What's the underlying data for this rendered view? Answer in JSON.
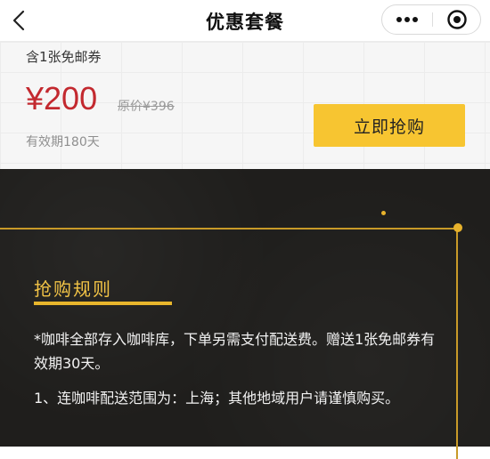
{
  "header": {
    "title": "优惠套餐",
    "back_icon": "chevron-left-icon",
    "more_icon": "more-dots-icon",
    "close_icon": "target-close-icon"
  },
  "product": {
    "coupon_text": "含1张免邮券",
    "price": "¥200",
    "original_price": "原价¥396",
    "validity": "有效期180天",
    "buy_label": "立即抢购"
  },
  "rules": {
    "title": "抢购规则",
    "paragraphs": [
      "*咖啡全部存入咖啡库，下单另需支付配送费。赠送1张免邮券有效期30天。",
      "1、连咖啡配送范围为：上海；其他地域用户请谨慎购买。"
    ]
  },
  "colors": {
    "price": "#c3292f",
    "accent": "#f7c531",
    "dark_bg": "#1f1e1c",
    "gold": "#e7b22c"
  }
}
